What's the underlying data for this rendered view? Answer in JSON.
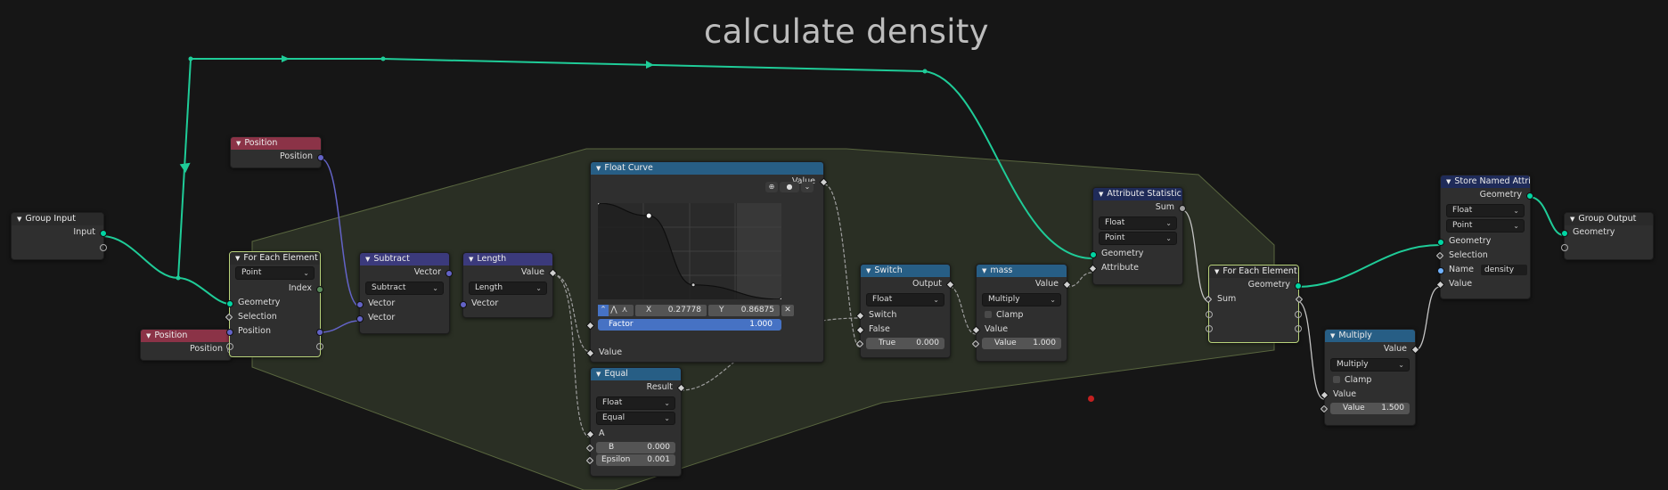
{
  "frame": {
    "label": "calculate density",
    "color": "#3d4531"
  },
  "nodes": {
    "group_input": {
      "title": "Group Input",
      "output": "Input"
    },
    "position_top": {
      "title": "Position",
      "output": "Position"
    },
    "position_bottom": {
      "title": "Position",
      "output": "Position"
    },
    "for_each_1": {
      "title": "For Each Element",
      "domain": "Point",
      "index": "Index",
      "inputs": [
        "Geometry",
        "Selection",
        "Position"
      ]
    },
    "subtract": {
      "title": "Subtract",
      "output": "Vector",
      "operation": "Subtract",
      "inputs": [
        "Vector",
        "Vector"
      ]
    },
    "length": {
      "title": "Length",
      "output": "Value",
      "operation": "Length",
      "input": "Vector"
    },
    "float_curve": {
      "title": "Float Curve",
      "output": "Value",
      "x_label": "X",
      "x_value": "0.27778",
      "y_label": "Y",
      "y_value": "0.86875",
      "factor_label": "Factor",
      "factor_value": "1.000",
      "input": "Value",
      "curve_points": [
        [
          0.0,
          1.0
        ],
        [
          0.27778,
          0.86875
        ],
        [
          0.52,
          0.15
        ],
        [
          1.0,
          0.0
        ]
      ]
    },
    "equal": {
      "title": "Equal",
      "output": "Result",
      "type": "Float",
      "mode": "Equal",
      "a": "A",
      "b_label": "B",
      "b_value": "0.000",
      "eps_label": "Epsilon",
      "eps_value": "0.001"
    },
    "switch": {
      "title": "Switch",
      "output": "Output",
      "type": "Float",
      "inputs": [
        "Switch",
        "False"
      ],
      "true_label": "True",
      "true_value": "0.000"
    },
    "mass": {
      "title": "mass",
      "output": "Value",
      "operation": "Multiply",
      "clamp": "Clamp",
      "value_label": "Value",
      "value_in": "Value",
      "value": "1.000"
    },
    "attr_stat": {
      "title": "Attribute Statistic",
      "output": "Sum",
      "type": "Float",
      "domain": "Point",
      "inputs": [
        "Geometry",
        "Attribute"
      ]
    },
    "for_each_2": {
      "title": "For Each Element",
      "output": "Geometry",
      "input": "Sum"
    },
    "store": {
      "title": "Store Named Attrib...",
      "output": "Geometry",
      "type": "Float",
      "domain": "Point",
      "inputs": [
        "Geometry",
        "Selection"
      ],
      "name_label": "Name",
      "name_value": "density",
      "value_in": "Value"
    },
    "multiply": {
      "title": "Multiply",
      "output": "Value",
      "operation": "Multiply",
      "clamp": "Clamp",
      "value_in": "Value",
      "value_label": "Value",
      "value": "1.500"
    },
    "group_output": {
      "title": "Group Output",
      "input": "Geometry"
    }
  }
}
